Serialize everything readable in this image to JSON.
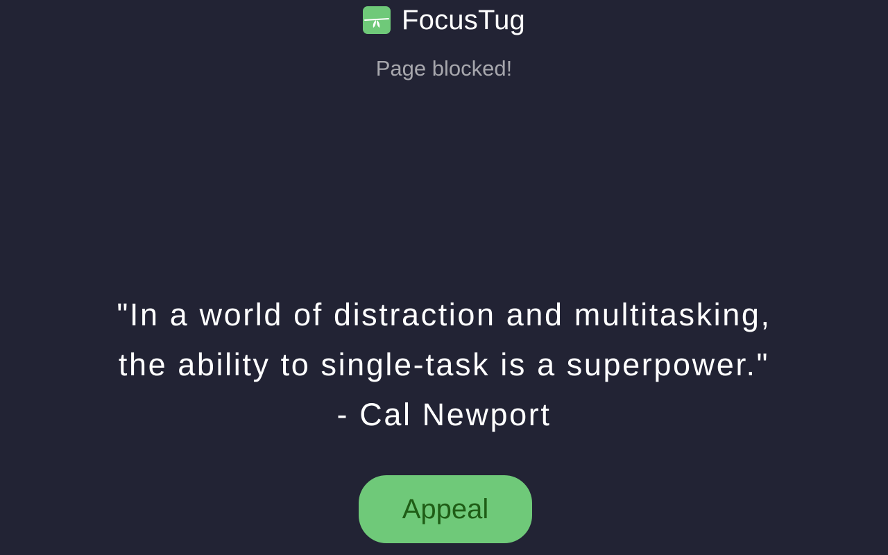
{
  "header": {
    "app_name": "FocusTug",
    "logo_icon": "focustug-logo-icon",
    "subtitle": "Page blocked!"
  },
  "quote": {
    "line1": "\"In a world of distraction and multitasking,",
    "line2": "the ability to single-task is a superpower.\"",
    "author": "- Cal Newport"
  },
  "actions": {
    "appeal_label": "Appeal"
  },
  "colors": {
    "background": "#222334",
    "accent": "#6fc979",
    "button_text": "#1f5d16",
    "subtitle_text": "#a7a7ad"
  }
}
